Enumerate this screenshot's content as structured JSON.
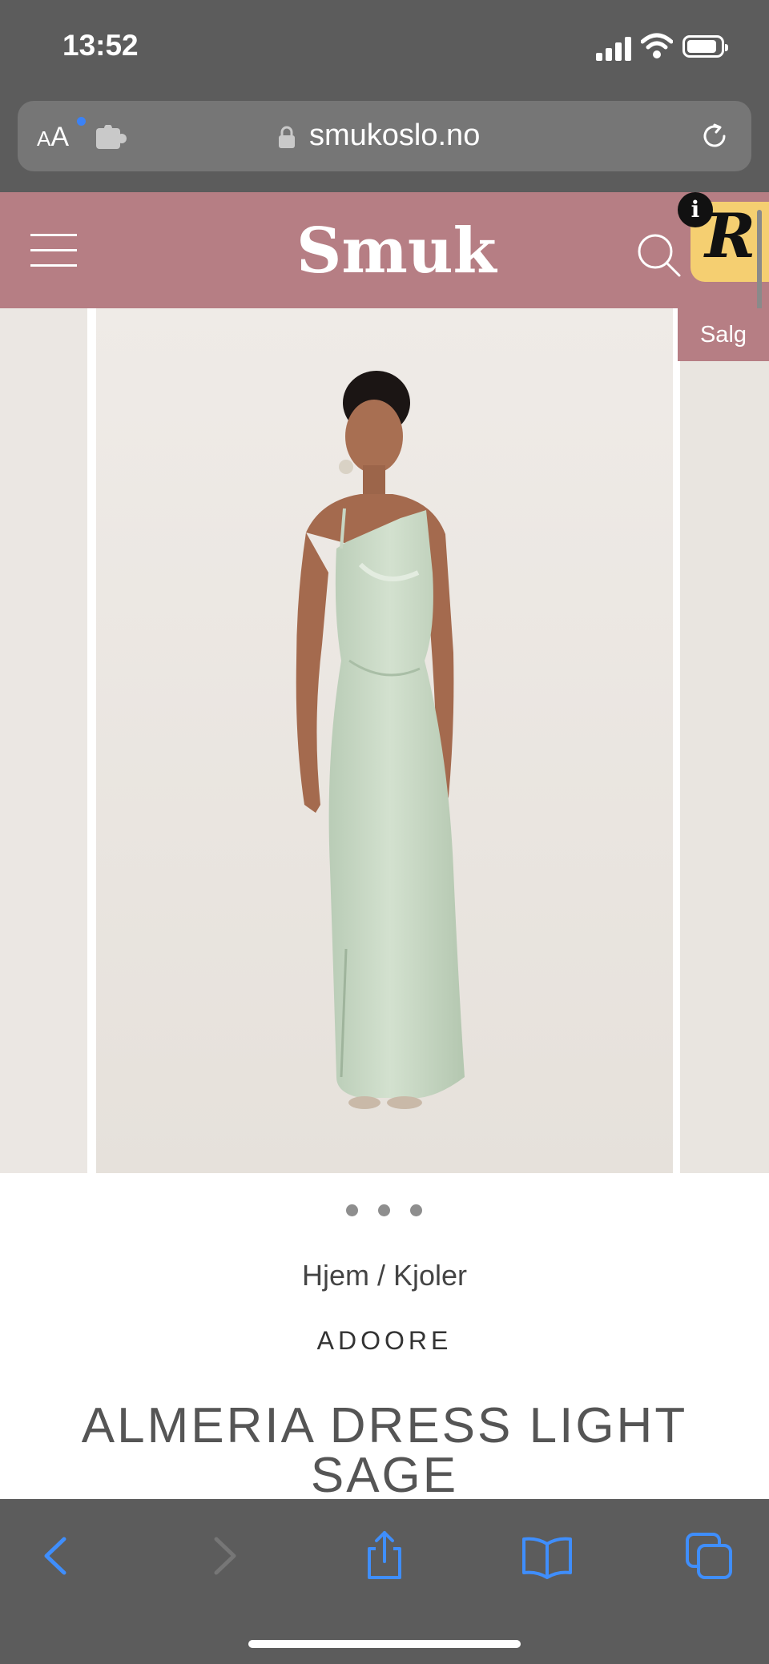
{
  "status_bar": {
    "time": "13:52"
  },
  "browser": {
    "text_size_label": "AA",
    "url": "smukoslo.no"
  },
  "site": {
    "logo": "Smuk",
    "badge_letter": "R",
    "info_label": "i",
    "sale_badge": "Salg"
  },
  "gallery": {
    "slide_count": 3,
    "active_slide": 1
  },
  "product": {
    "breadcrumb": "Hjem / Kjoler",
    "brand": "ADOORE",
    "title": "ALMERIA DRESS LIGHT SAGE"
  },
  "colors": {
    "header_pink": "#b67e84",
    "badge_yellow": "#f5cf71",
    "dress_sage": "#c5d6c2",
    "ios_blue": "#3f8efc"
  }
}
